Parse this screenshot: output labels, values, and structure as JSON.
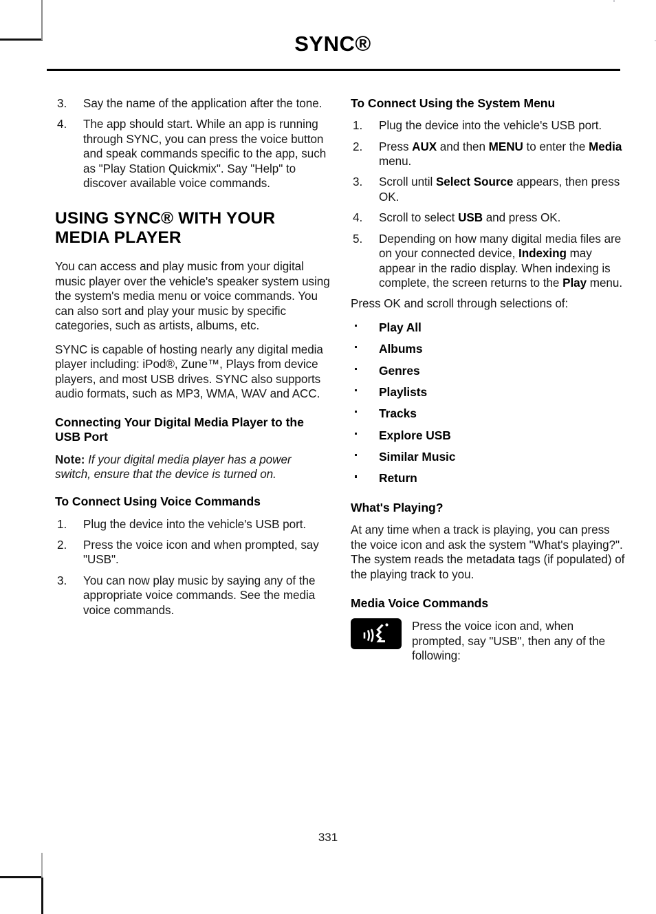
{
  "header": {
    "title": "SYNC®"
  },
  "page_number": "331",
  "left_column": {
    "continued_list": [
      {
        "marker": "3.",
        "text": "Say the name of the application after the tone."
      },
      {
        "marker": "4.",
        "text": "The app should start. While an app is running through SYNC, you can press the voice button and speak commands specific to the app, such as \"Play Station Quickmix\". Say \"Help\" to discover available voice commands."
      }
    ],
    "section_title": "USING SYNC® WITH YOUR MEDIA PLAYER",
    "paragraph_1": "You can access and play music from your digital music player over the vehicle's speaker system using the system's media menu or voice commands. You can also sort and play your music by specific categories, such as artists, albums, etc.",
    "paragraph_2": "SYNC is capable of hosting nearly any digital media player including: iPod®, Zune™, Plays from device players, and most USB drives. SYNC also supports audio formats, such as MP3, WMA, WAV and ACC.",
    "subheading_connecting": "Connecting Your Digital Media Player to the USB Port",
    "note_label": "Note:",
    "note_text": "If your digital media player has a power switch, ensure that the device is turned on.",
    "subheading_voice_commands": "To Connect Using Voice Commands",
    "voice_steps": [
      {
        "marker": "1.",
        "text": "Plug the device into the vehicle's USB port."
      },
      {
        "marker": "2.",
        "text": "Press the voice icon and when prompted, say \"USB\"."
      },
      {
        "marker": "3.",
        "text": "You can now play music by saying any of the appropriate voice commands. See the media voice commands."
      }
    ]
  },
  "right_column": {
    "subheading_system_menu": "To Connect Using the System Menu",
    "system_steps": [
      {
        "marker": "1.",
        "parts": [
          {
            "t": "Plug the device into the vehicle's USB port.",
            "b": false
          }
        ]
      },
      {
        "marker": "2.",
        "parts": [
          {
            "t": "Press ",
            "b": false
          },
          {
            "t": "AUX",
            "b": true
          },
          {
            "t": " and then ",
            "b": false
          },
          {
            "t": "MENU",
            "b": true
          },
          {
            "t": " to enter the ",
            "b": false
          },
          {
            "t": "Media",
            "b": true
          },
          {
            "t": " menu.",
            "b": false
          }
        ]
      },
      {
        "marker": "3.",
        "parts": [
          {
            "t": "Scroll until ",
            "b": false
          },
          {
            "t": "Select Source",
            "b": true
          },
          {
            "t": " appears, then press OK.",
            "b": false
          }
        ]
      },
      {
        "marker": "4.",
        "parts": [
          {
            "t": "Scroll to select ",
            "b": false
          },
          {
            "t": "USB",
            "b": true
          },
          {
            "t": " and press OK.",
            "b": false
          }
        ]
      },
      {
        "marker": "5.",
        "parts": [
          {
            "t": "Depending on how many digital media files are on your connected device, ",
            "b": false
          },
          {
            "t": "Indexing",
            "b": true
          },
          {
            "t": " may appear in the radio display. When indexing is complete, the screen returns to the ",
            "b": false
          },
          {
            "t": "Play",
            "b": true
          },
          {
            "t": " menu.",
            "b": false
          }
        ]
      }
    ],
    "selections_intro": "Press OK and scroll through selections of:",
    "selections": [
      "Play All",
      "Albums",
      "Genres",
      "Playlists",
      "Tracks",
      "Explore USB",
      "Similar Music",
      "Return"
    ],
    "subheading_whats_playing": "What's Playing?",
    "whats_playing_text": "At any time when a track is playing, you can press the voice icon and ask the system \"What's playing?\". The system reads the metadata tags (if populated) of the playing track to you.",
    "subheading_media_voice": "Media Voice Commands",
    "voice_icon_name": "voice-command-icon",
    "voice_icon_text": "Press the voice icon and, when prompted, say \"USB\", then any of the following:"
  },
  "colors": {
    "text": "#161616",
    "rule": "#000000",
    "icon_background": "#000000",
    "icon_glyph": "#ffffff"
  }
}
